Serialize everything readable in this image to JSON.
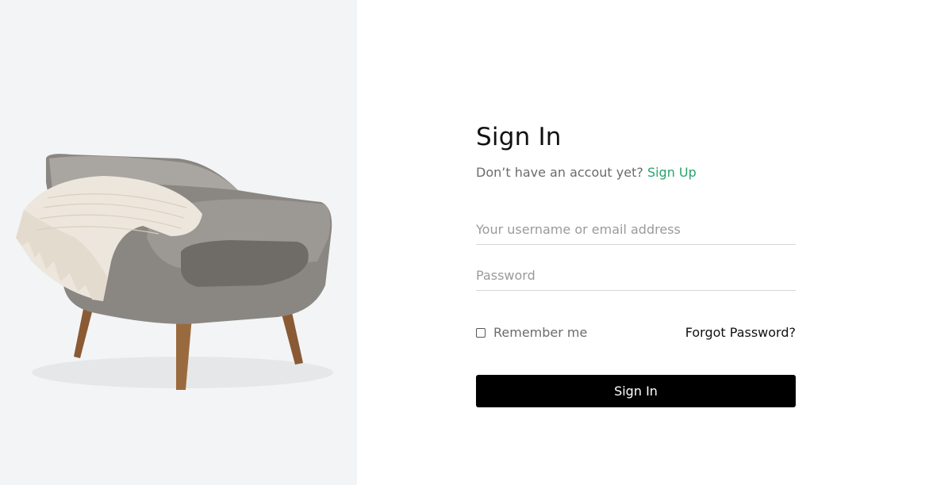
{
  "hero": {
    "image_name": "armchair-with-throw-blanket"
  },
  "form": {
    "title": "Sign In",
    "subtitle_text": "Don’t have an accout yet?",
    "signup_link": "Sign Up",
    "username_placeholder": "Your username or email address",
    "password_placeholder": "Password",
    "remember_label": "Remember me",
    "forgot_link": "Forgot Password?",
    "submit_label": "Sign In"
  },
  "colors": {
    "accent": "#27a36c",
    "button": "#000000",
    "panel": "#f3f4f6"
  }
}
